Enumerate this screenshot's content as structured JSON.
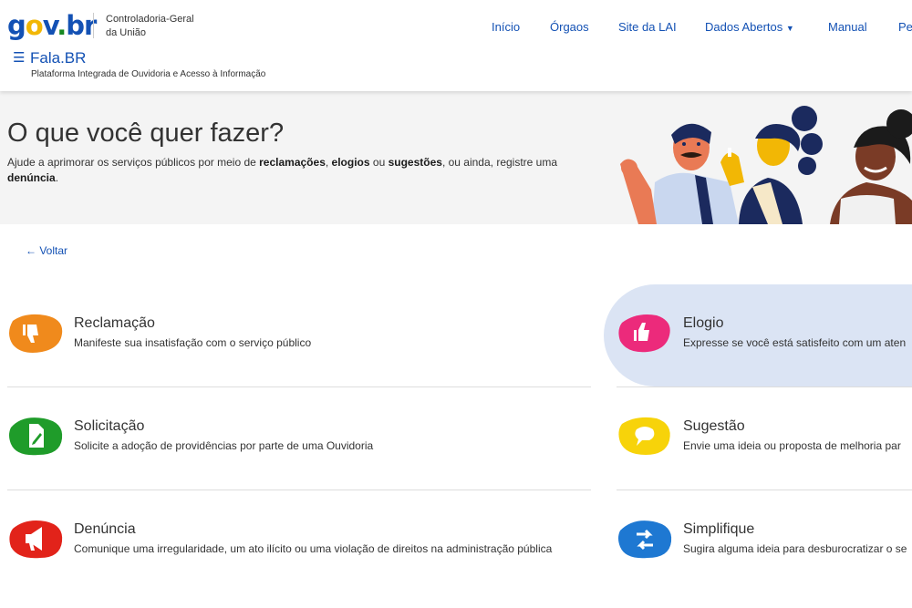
{
  "header": {
    "logo": {
      "g": "g",
      "o": "o",
      "v": "v",
      "dot": ".",
      "br": "br"
    },
    "org_line1": "Controladoria-Geral",
    "org_line2": "da União",
    "nav": [
      "Início",
      "Órgaos",
      "Site da LAI",
      "Dados Abertos",
      "Manual",
      "Pe"
    ],
    "app_name": "Fala.BR",
    "app_subtitle": "Plataforma Integrada de Ouvidoria e Acesso à Informação"
  },
  "banner": {
    "title": "O que você quer fazer?",
    "text_1": "Ajude a aprimorar os serviços públicos por meio de ",
    "bold_1": "reclamações",
    "text_2": ", ",
    "bold_2": "elogios",
    "text_3": " ou ",
    "bold_3": "sugestões",
    "text_4": ", ou ainda, registre uma ",
    "bold_4": "denúncia",
    "text_5": "."
  },
  "back": "← Voltar",
  "options": [
    {
      "title": "Reclamação",
      "desc": "Manifeste sua insatisfação com o serviço público",
      "color": "#f08a1c",
      "icon": "thumbs-down-icon"
    },
    {
      "title": "Elogio",
      "desc": "Expresse se você está satisfeito com um aten",
      "color": "#ec2a7b",
      "icon": "thumbs-up-icon"
    },
    {
      "title": "Solicitação",
      "desc": "Solicite a adoção de providências por parte de uma Ouvidoria",
      "color": "#1f9c2a",
      "icon": "document-edit-icon"
    },
    {
      "title": "Sugestão",
      "desc": "Envie uma ideia ou proposta de melhoria par",
      "color": "#f7d30a",
      "icon": "speech-bubble-icon"
    },
    {
      "title": "Denúncia",
      "desc": "Comunique uma irregularidade, um ato ilícito ou uma violação de direitos na administração pública",
      "color": "#e2231a",
      "icon": "megaphone-icon"
    },
    {
      "title": "Simplifique",
      "desc": "Sugira alguma ideia para desburocratizar o se",
      "color": "#1e78d2",
      "icon": "arrows-icon"
    }
  ]
}
